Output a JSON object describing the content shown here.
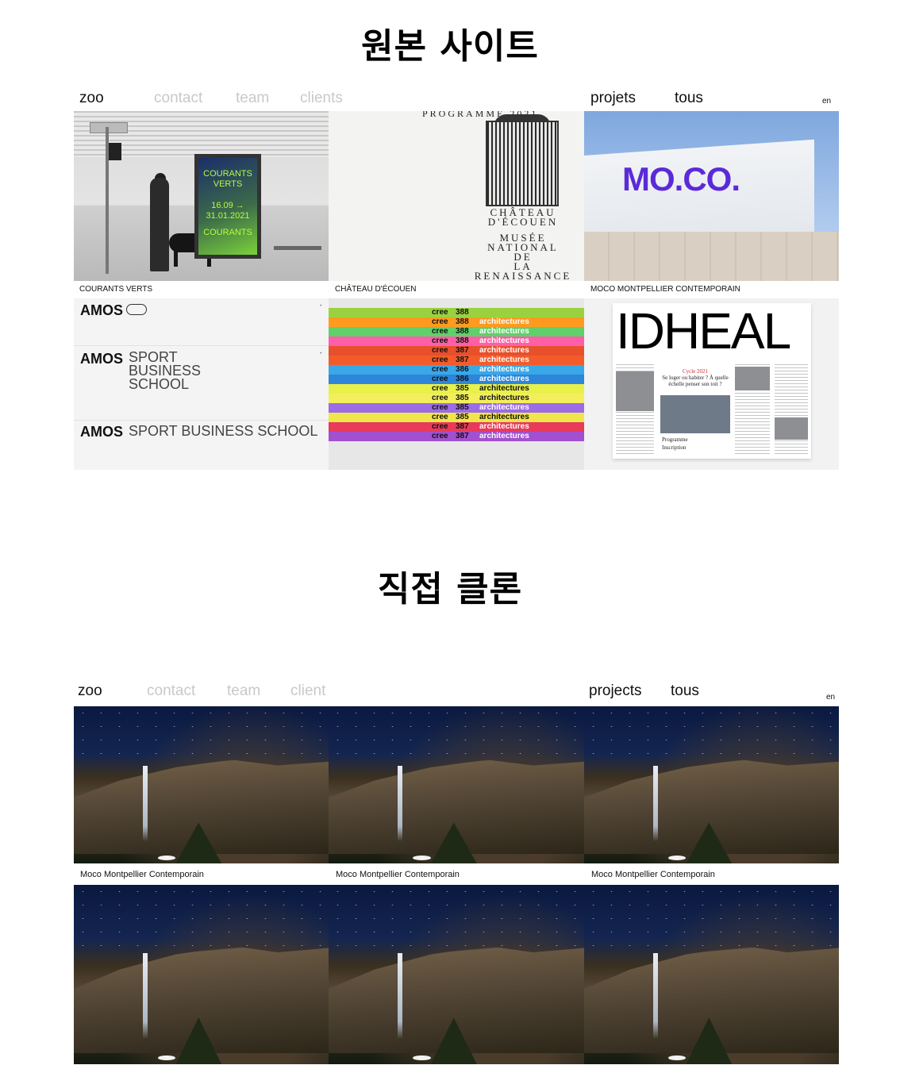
{
  "headings": {
    "original": "원본 사이트",
    "clone": "직접 클론"
  },
  "original_site": {
    "nav": {
      "logo": "zoo",
      "contact": "contact",
      "team": "team",
      "clients": "clients",
      "projects": "projets",
      "all": "tous",
      "lang": "en"
    },
    "tiles": [
      {
        "caption": "COURANTS VERTS",
        "poster_text": [
          "COURANTS",
          "VERTS",
          "16.09 →",
          "31.01.2021",
          "COURANTS"
        ]
      },
      {
        "caption": "CHÂTEAU D'ÉCOUEN",
        "top_text": "PROGRAMME 2021",
        "lines": [
          "CHÂTEAU",
          "D'ÉCOUEN",
          "MUSÉE",
          "NATIONAL",
          "DE",
          "LA",
          "RENAISSANCE"
        ]
      },
      {
        "caption": "MOCO MONTPELLIER CONTEMPORAIN",
        "logo": "MO.CO."
      },
      {
        "caption": "",
        "amos_word": "AMOS",
        "stacked": "SPORT\nBUSINESS\nSCHOOL",
        "inline": "SPORT BUSINESS SCHOOL"
      },
      {
        "caption": "",
        "magazine_word": "cree",
        "issues": [
          "388",
          "388",
          "388",
          "388",
          "387",
          "387",
          "386",
          "386",
          "385",
          "385",
          "385",
          "385",
          "387",
          "387"
        ],
        "label": "architectures"
      },
      {
        "caption": "",
        "title": "IDHEAL",
        "cycle": "Cycle 2021",
        "question": "Se loger ou habiter ? À quelle échelle penser son toit ?",
        "programme": "Programme",
        "inscription": "Inscription"
      }
    ],
    "colors": {
      "nav_muted": "#c9c9c9",
      "moco_purple": "#5b2ad8",
      "poster_green": "#b6ff3a"
    }
  },
  "clone_site": {
    "nav": {
      "logo": "zoo",
      "contact": "contact",
      "team": "team",
      "client": "client",
      "projects": "projects",
      "all": "tous",
      "lang": "en"
    },
    "captions": [
      "Moco Montpellier Contemporain",
      "Moco Montpellier Contemporain",
      "Moco Montpellier Contemporain"
    ]
  }
}
